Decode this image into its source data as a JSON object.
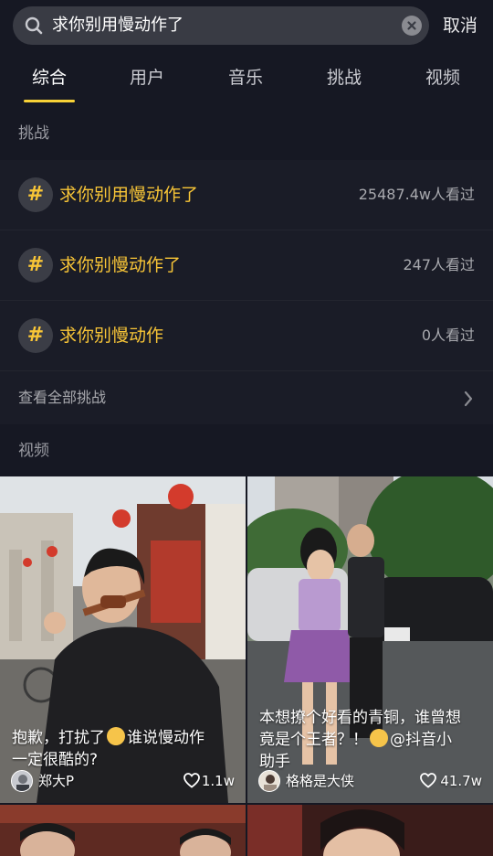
{
  "search": {
    "query": "求你别用慢动作了",
    "cancel_label": "取消"
  },
  "tabs": [
    {
      "label": "综合",
      "active": true
    },
    {
      "label": "用户",
      "active": false
    },
    {
      "label": "音乐",
      "active": false
    },
    {
      "label": "挑战",
      "active": false
    },
    {
      "label": "视频",
      "active": false
    }
  ],
  "challenges_section": {
    "title": "挑战",
    "items": [
      {
        "name": "求你别用慢动作了",
        "views": "25487.4w人看过"
      },
      {
        "name": "求你别慢动作了",
        "views": "247人看过"
      },
      {
        "name": "求你别慢动作",
        "views": "0人看过"
      }
    ],
    "see_all_label": "查看全部挑战"
  },
  "videos_section": {
    "title": "视频",
    "cards": [
      {
        "caption_line1": "抱歉，打扰了",
        "caption_line1b": "谁说慢动作",
        "caption_line2": "一定很酷的?",
        "author": "郑大P",
        "likes": "1.1w"
      },
      {
        "caption_line1": "本想撩个好看的青铜，谁曾想",
        "caption_line2a": "竟是个王者？！",
        "caption_line2b": "@抖音小",
        "caption_line3": "助手",
        "author": "格格是大侠",
        "likes": "41.7w"
      }
    ]
  },
  "colors": {
    "background": "#161823",
    "accent_yellow": "#f8c537",
    "tab_underline": "#f8d237"
  }
}
